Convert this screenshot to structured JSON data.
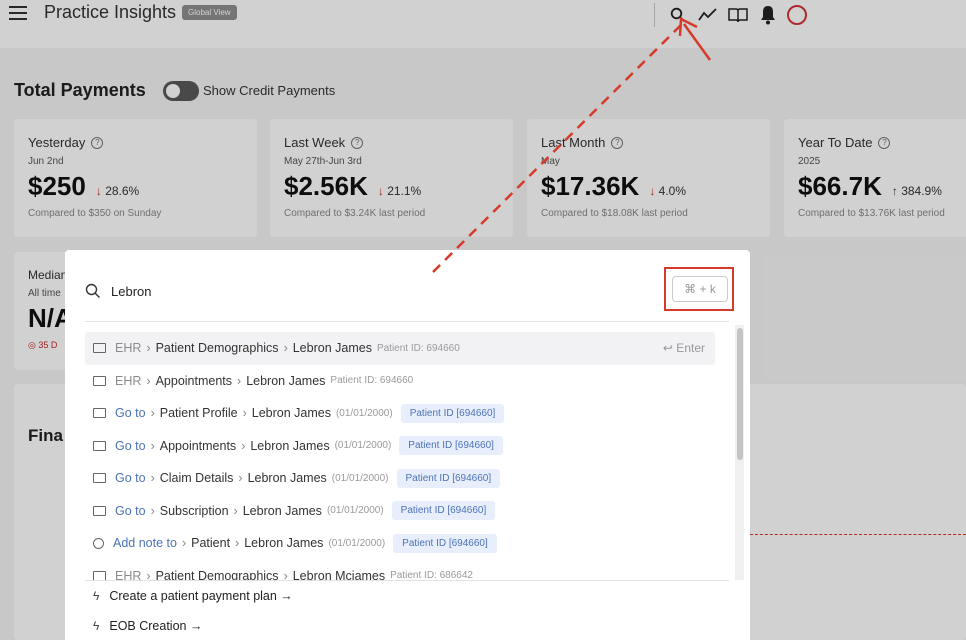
{
  "header": {
    "title": "Practice Insights",
    "view_badge": "Global View"
  },
  "payments": {
    "section_title": "Total Payments",
    "toggle_label": "Show Credit Payments",
    "toggle_on": false,
    "cards": [
      {
        "label": "Yesterday",
        "sub": "Jun 2nd",
        "value": "$250",
        "change": "28.6%",
        "direction": "down",
        "foot": "Compared to $350 on Sunday"
      },
      {
        "label": "Last Week",
        "sub": "May 27th-Jun 3rd",
        "value": "$2.56K",
        "change": "21.1%",
        "direction": "down",
        "foot": "Compared to $3.24K last period"
      },
      {
        "label": "Last Month",
        "sub": "May",
        "value": "$17.36K",
        "change": "4.0%",
        "direction": "down",
        "foot": "Compared to $18.08K last period"
      },
      {
        "label": "Year To Date",
        "sub": "2025",
        "value": "$66.7K",
        "change": "384.9%",
        "direction": "up",
        "foot": "Compared to $13.76K last period"
      }
    ],
    "median_card": {
      "label": "Median",
      "sub": "All time",
      "value": "N/A",
      "foot": "35 D"
    }
  },
  "financial_section_title": "Fina",
  "search": {
    "query": "Lebron",
    "shortcut": "⌘ + k",
    "results": [
      {
        "icon": "window-icon",
        "source": "EHR",
        "source_style": "gray",
        "path": [
          "Patient Demographics",
          "Lebron James"
        ],
        "meta": "Patient ID: 694660",
        "badge": "",
        "enter": "↩ Enter",
        "active": true
      },
      {
        "icon": "window-icon",
        "source": "EHR",
        "source_style": "gray",
        "path": [
          "Appointments",
          "Lebron James"
        ],
        "meta": "Patient ID: 694660",
        "badge": "",
        "enter": "",
        "active": false
      },
      {
        "icon": "window-icon",
        "source": "Go to",
        "source_style": "blue",
        "path": [
          "Patient Profile",
          "Lebron James"
        ],
        "meta": "(01/01/2000)",
        "badge": "Patient ID [694660]",
        "enter": "",
        "active": false
      },
      {
        "icon": "window-icon",
        "source": "Go to",
        "source_style": "blue",
        "path": [
          "Appointments",
          "Lebron James"
        ],
        "meta": "(01/01/2000)",
        "badge": "Patient ID [694660]",
        "enter": "",
        "active": false
      },
      {
        "icon": "window-icon",
        "source": "Go to",
        "source_style": "blue",
        "path": [
          "Claim Details",
          "Lebron James"
        ],
        "meta": "(01/01/2000)",
        "badge": "Patient ID [694660]",
        "enter": "",
        "active": false
      },
      {
        "icon": "window-icon",
        "source": "Go to",
        "source_style": "blue",
        "path": [
          "Subscription",
          "Lebron James"
        ],
        "meta": "(01/01/2000)",
        "badge": "Patient ID [694660]",
        "enter": "",
        "active": false
      },
      {
        "icon": "note-icon",
        "source": "Add note to",
        "source_style": "blue",
        "path": [
          "Patient",
          "Lebron James"
        ],
        "meta": "(01/01/2000)",
        "badge": "Patient ID [694660]",
        "enter": "",
        "active": false
      },
      {
        "icon": "window-icon",
        "source": "EHR",
        "source_style": "gray",
        "path": [
          "Patient Demographics",
          "Lebron Mciames"
        ],
        "meta": "Patient ID: 686642",
        "badge": "",
        "enter": "",
        "active": false
      }
    ],
    "actions": [
      {
        "icon": "bolt-icon",
        "label": "Create a patient payment plan →"
      },
      {
        "icon": "bolt-icon",
        "label": "EOB Creation →"
      }
    ]
  },
  "colors": {
    "accent_red": "#d63a2a",
    "link_blue": "#4c73b8",
    "badge_bg": "#e8eefb",
    "avatar_ring": "#d3343a"
  }
}
